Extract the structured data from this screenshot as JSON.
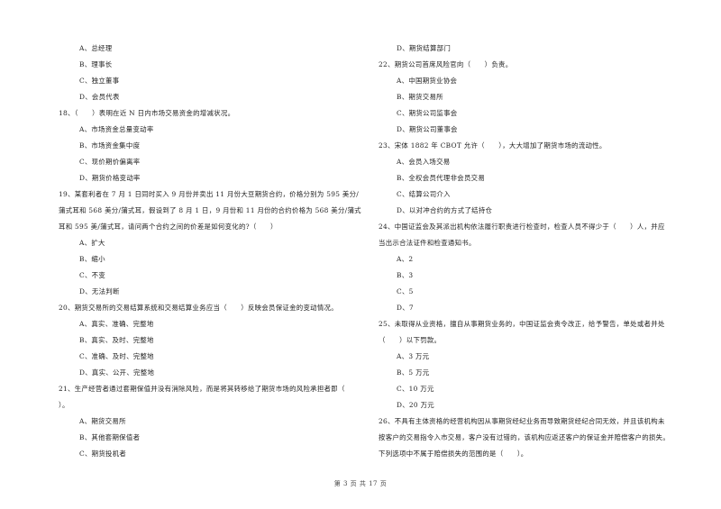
{
  "page": {
    "footer": "第 3 页 共 17 页"
  },
  "left": [
    {
      "type": "opt",
      "text": "A、总经理"
    },
    {
      "type": "opt",
      "text": "B、理事长"
    },
    {
      "type": "opt",
      "text": "C、独立董事"
    },
    {
      "type": "opt",
      "text": "D、会员代表"
    },
    {
      "type": "q",
      "text": "18、（　　）表明在近 N 日内市场交易资金的增减状况。"
    },
    {
      "type": "opt",
      "text": "A、市场资金总量变动率"
    },
    {
      "type": "opt",
      "text": "B、市场资金集中度"
    },
    {
      "type": "opt",
      "text": "C、现价期价偏离率"
    },
    {
      "type": "opt",
      "text": "D、期货价格变动率"
    },
    {
      "type": "q",
      "text": "19、某套利者在 7 月 1 日同时买入 9 月份并卖出 11 月份大豆期货合约，价格分别为 595 美分/"
    },
    {
      "type": "q",
      "text": "蒲式耳和 568 美分/蒲式耳，假设到了 8 月 1 日，9 月份和 11 月份的合约价格为 568 美分/蒲式"
    },
    {
      "type": "q",
      "text": "耳和 595 美/蒲式耳，请问两个合约之间的价差是如何变化的?（　　）"
    },
    {
      "type": "opt",
      "text": "A、扩大"
    },
    {
      "type": "opt",
      "text": "B、缩小"
    },
    {
      "type": "opt",
      "text": "C、不变"
    },
    {
      "type": "opt",
      "text": "D、无法判断"
    },
    {
      "type": "q",
      "text": "20、期货交易所的交易结算系统和交易结算业务应当（　　）反映会员保证金的变动情况。"
    },
    {
      "type": "opt",
      "text": "A、真实、准确、完整地"
    },
    {
      "type": "opt",
      "text": "B、真实、及时、完整地"
    },
    {
      "type": "opt",
      "text": "C、准确、及时、完整地"
    },
    {
      "type": "opt",
      "text": "D、真实、公开、完整地"
    },
    {
      "type": "q",
      "text": "21、生产经营者通过套期保值并没有消除风险，而是将其转移给了期货市场的风险承担者即（"
    },
    {
      "type": "q",
      "text": "）。"
    },
    {
      "type": "opt",
      "text": "A、期货交易所"
    },
    {
      "type": "opt",
      "text": "B、其他套期保值者"
    },
    {
      "type": "opt",
      "text": "C、期货投机者"
    }
  ],
  "right": [
    {
      "type": "opt",
      "text": "D、期货结算部门"
    },
    {
      "type": "q",
      "text": "22、期货公司首席风险官向（　　）负责。"
    },
    {
      "type": "opt",
      "text": "A、中国期货业协会"
    },
    {
      "type": "opt",
      "text": "B、期货交易所"
    },
    {
      "type": "opt",
      "text": "C、期货公司监事会"
    },
    {
      "type": "opt",
      "text": "D、期货公司董事会"
    },
    {
      "type": "q",
      "text": "23、宋体 1882 年 CBOT 允许（　　），大大增加了期货市场的流动性。"
    },
    {
      "type": "opt",
      "text": "A、会员入场交易"
    },
    {
      "type": "opt",
      "text": "B、全权会员代理非会员交易"
    },
    {
      "type": "opt",
      "text": "C、结算公司介入"
    },
    {
      "type": "opt",
      "text": "D、以对冲合约的方式了结持仓"
    },
    {
      "type": "q",
      "text": "24、中国证监会及其派出机构依法履行职责进行检查时，检查人员不得少于（　　）人，并应"
    },
    {
      "type": "q",
      "text": "当出示合法证件和检查通知书。"
    },
    {
      "type": "opt",
      "text": "A、2"
    },
    {
      "type": "opt",
      "text": "B、3"
    },
    {
      "type": "opt",
      "text": "C、5"
    },
    {
      "type": "opt",
      "text": "D、7"
    },
    {
      "type": "q",
      "text": "25、未取得从业资格，擅自从事期货业务的，中国证监会责令改正，给予警告，单处或者并处"
    },
    {
      "type": "q",
      "text": "（　　）以下罚款。"
    },
    {
      "type": "opt",
      "text": "A、3 万元"
    },
    {
      "type": "opt",
      "text": "B、5 万元"
    },
    {
      "type": "opt",
      "text": "C、10 万元"
    },
    {
      "type": "opt",
      "text": "D、20 万元"
    },
    {
      "type": "q",
      "text": "26、不具有主体资格的经营机构因从事期货经纪业务而导致期货经纪合同无效，并且该机构未"
    },
    {
      "type": "q",
      "text": "按客户的交易指令入市交易，客户没有过错的，该机构应返还客户的保证金并赔偿客户的损失。"
    },
    {
      "type": "q",
      "text": "下列选项中不属于赔偿损失的范围的是（　　）。"
    }
  ]
}
